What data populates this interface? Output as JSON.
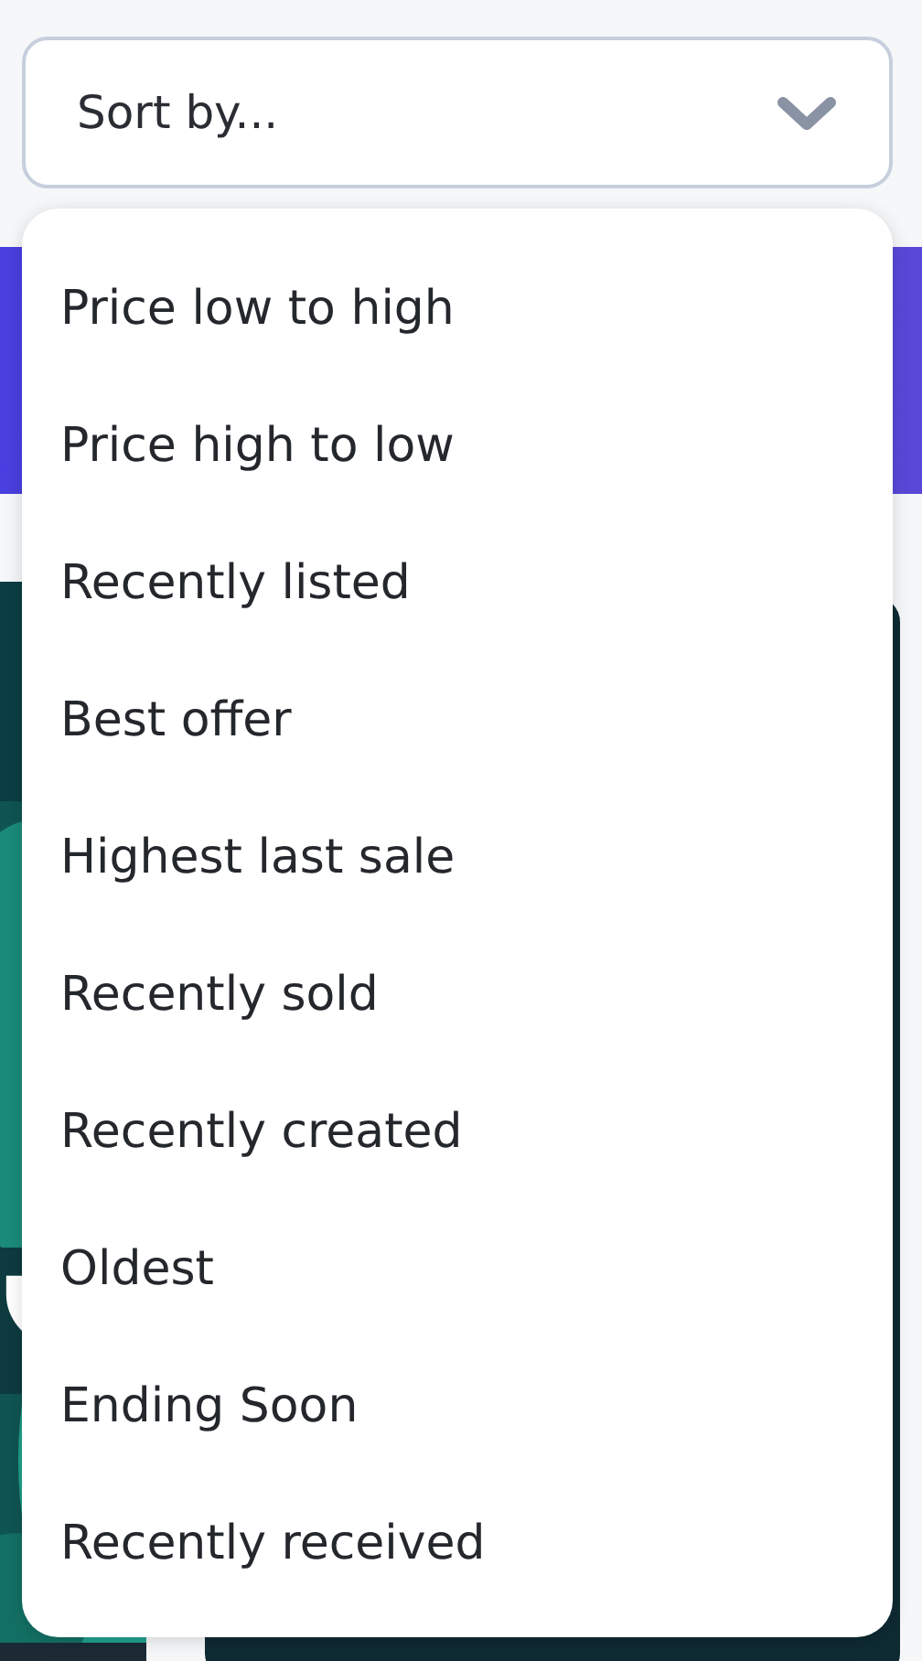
{
  "sort_field": {
    "placeholder": "Sort by..."
  },
  "menu": {
    "items": [
      {
        "label": "Price low to high"
      },
      {
        "label": "Price high to low"
      },
      {
        "label": "Recently listed"
      },
      {
        "label": "Best offer"
      },
      {
        "label": "Highest last sale"
      },
      {
        "label": "Recently sold"
      },
      {
        "label": "Recently created"
      },
      {
        "label": "Oldest"
      },
      {
        "label": "Ending Soon"
      },
      {
        "label": "Recently received"
      }
    ]
  }
}
